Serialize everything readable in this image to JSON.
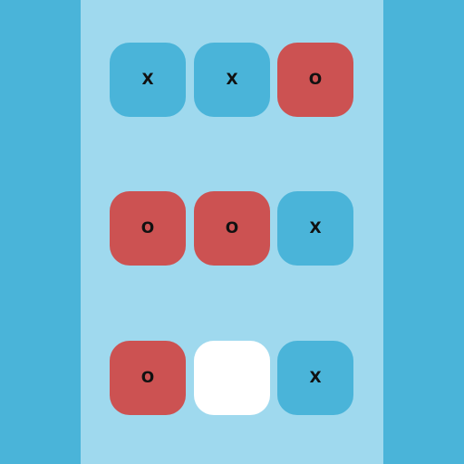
{
  "colors": {
    "background": "#4ab4d9",
    "board_panel": "#9fd9ee",
    "x_cell": "#4ab4d9",
    "o_cell": "#cc5252",
    "empty_cell": "#ffffff"
  },
  "board": {
    "cells": [
      {
        "mark": "X",
        "state": "x"
      },
      {
        "mark": "X",
        "state": "x"
      },
      {
        "mark": "O",
        "state": "o"
      },
      {
        "mark": "O",
        "state": "o"
      },
      {
        "mark": "O",
        "state": "o"
      },
      {
        "mark": "X",
        "state": "x"
      },
      {
        "mark": "O",
        "state": "o"
      },
      {
        "mark": "",
        "state": "empty"
      },
      {
        "mark": "X",
        "state": "x"
      }
    ]
  }
}
